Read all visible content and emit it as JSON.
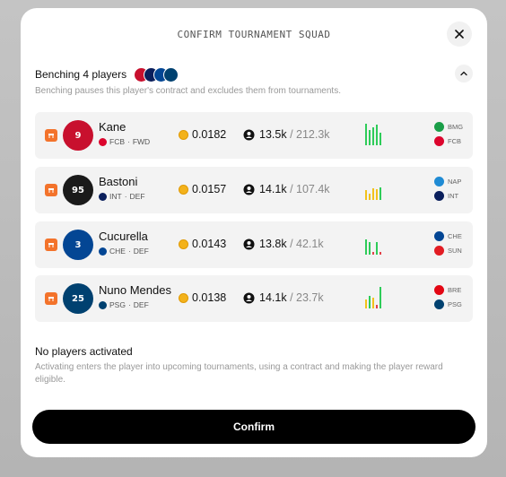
{
  "header": {
    "title": "CONFIRM TOURNAMENT SQUAD"
  },
  "benching": {
    "title": "Benching 4 players",
    "description": "Benching pauses this player's contract and excludes them from tournaments.",
    "players": [
      {
        "name": "Kane",
        "club": "FCB",
        "position": "FWD",
        "price": "0.0182",
        "count": "13.5k",
        "total": "/ 212.3k",
        "opponents": [
          "BMG",
          "FCB"
        ],
        "form": [
          1.0,
          0.7,
          0.85,
          0.95,
          0.6
        ],
        "colors": {
          "avatar": "#c8102e",
          "club": "#dc052d",
          "opp1": "#1a9e48",
          "opp2": "#dc052d"
        },
        "number": "9"
      },
      {
        "name": "Bastoni",
        "club": "INT",
        "position": "DEF",
        "price": "0.0157",
        "count": "14.1k",
        "total": "/ 107.4k",
        "opponents": [
          "NAP",
          "INT"
        ],
        "form": [
          0.45,
          0.3,
          0.55,
          0.5,
          0.6
        ],
        "colors": {
          "avatar": "#1a1a1a",
          "club": "#0a1f5c",
          "opp1": "#1f8bd4",
          "opp2": "#0a1f5c"
        },
        "number": "95"
      },
      {
        "name": "Cucurella",
        "club": "CHE",
        "position": "DEF",
        "price": "0.0143",
        "count": "13.8k",
        "total": "/ 42.1k",
        "opponents": [
          "CHE",
          "SUN"
        ],
        "form": [
          0.7,
          0.6,
          0.1,
          0.6,
          0.1
        ],
        "colors": {
          "avatar": "#034694",
          "club": "#034694",
          "opp1": "#034694",
          "opp2": "#e21c23"
        },
        "number": "3"
      },
      {
        "name": "Nuno Mendes",
        "club": "PSG",
        "position": "DEF",
        "price": "0.0138",
        "count": "14.1k",
        "total": "/ 23.7k",
        "opponents": [
          "BRE",
          "PSG"
        ],
        "form": [
          0.4,
          0.6,
          0.5,
          0.15,
          1.0
        ],
        "colors": {
          "avatar": "#004170",
          "club": "#004170",
          "opp1": "#e30613",
          "opp2": "#004170"
        },
        "number": "25"
      }
    ]
  },
  "activating": {
    "title": "No players activated",
    "description": "Activating enters the player into upcoming tournaments, using a contract and making the player reward eligible."
  },
  "confirm_label": "Confirm",
  "icons": {
    "close": "close-icon",
    "collapse": "chevron-up-icon",
    "bench": "bench-icon",
    "coin": "coin-icon",
    "followers": "users-icon"
  },
  "accent": "#f3732b"
}
